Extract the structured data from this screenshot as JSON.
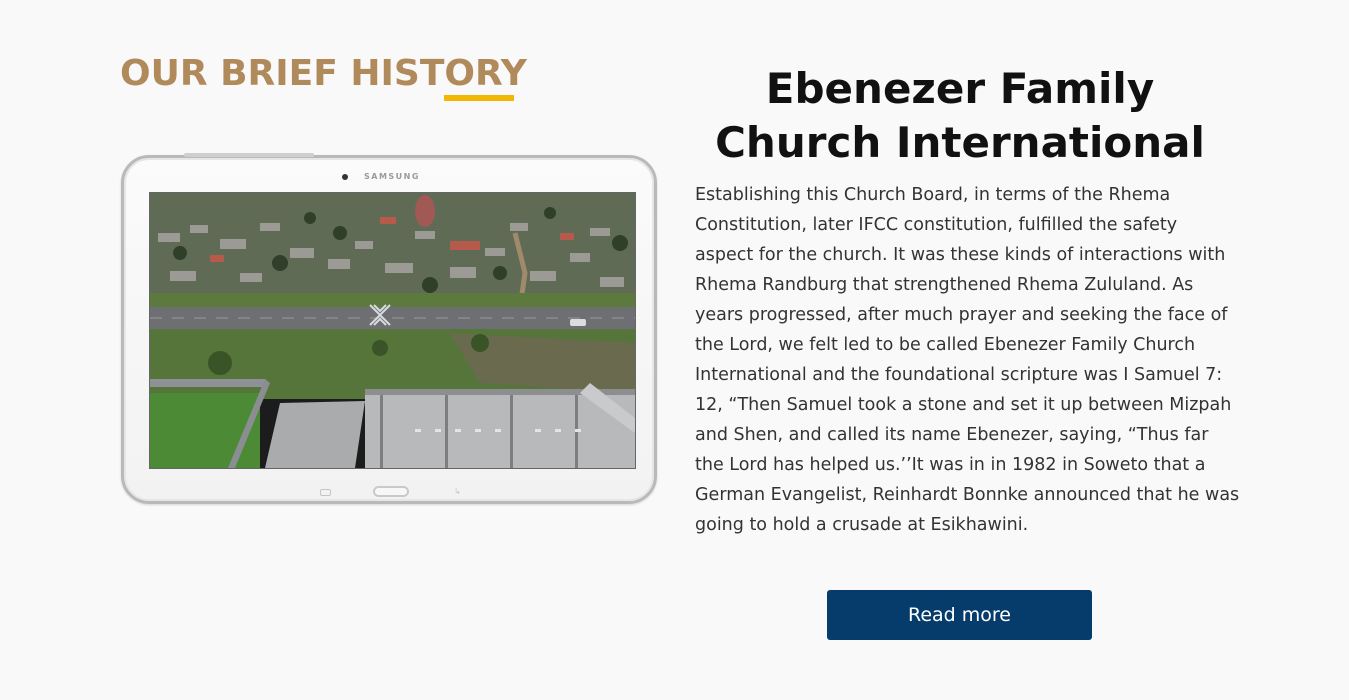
{
  "history": {
    "heading": "OUR BRIEF HISTORY",
    "accent_color": "#b08a5b",
    "underline_color": "#f2b705"
  },
  "tablet": {
    "brand": "SAMSUNG"
  },
  "church": {
    "title": "Ebenezer Family Church International",
    "body": "Establishing this Church Board, in terms of the Rhema Constitution, later IFCC constitution, fulfilled the safety aspect for the church. It was these kinds of interactions with Rhema Randburg that strengthened Rhema Zululand. As years progressed, after much prayer and seeking the face of the Lord, we felt led to be called Ebenezer Family Church International and the foundational scripture was I Samuel 7: 12, “Then Samuel took a stone and set it up between Mizpah and Shen, and called its name Ebenezer, saying, “Thus far the Lord has helped us.’’It was in in 1982 in Soweto that a German Evangelist, Reinhardt Bonnke announced that he was going to hold a crusade at Esikhawini."
  },
  "actions": {
    "read_more_label": "Read more",
    "button_color": "#063c6c"
  }
}
